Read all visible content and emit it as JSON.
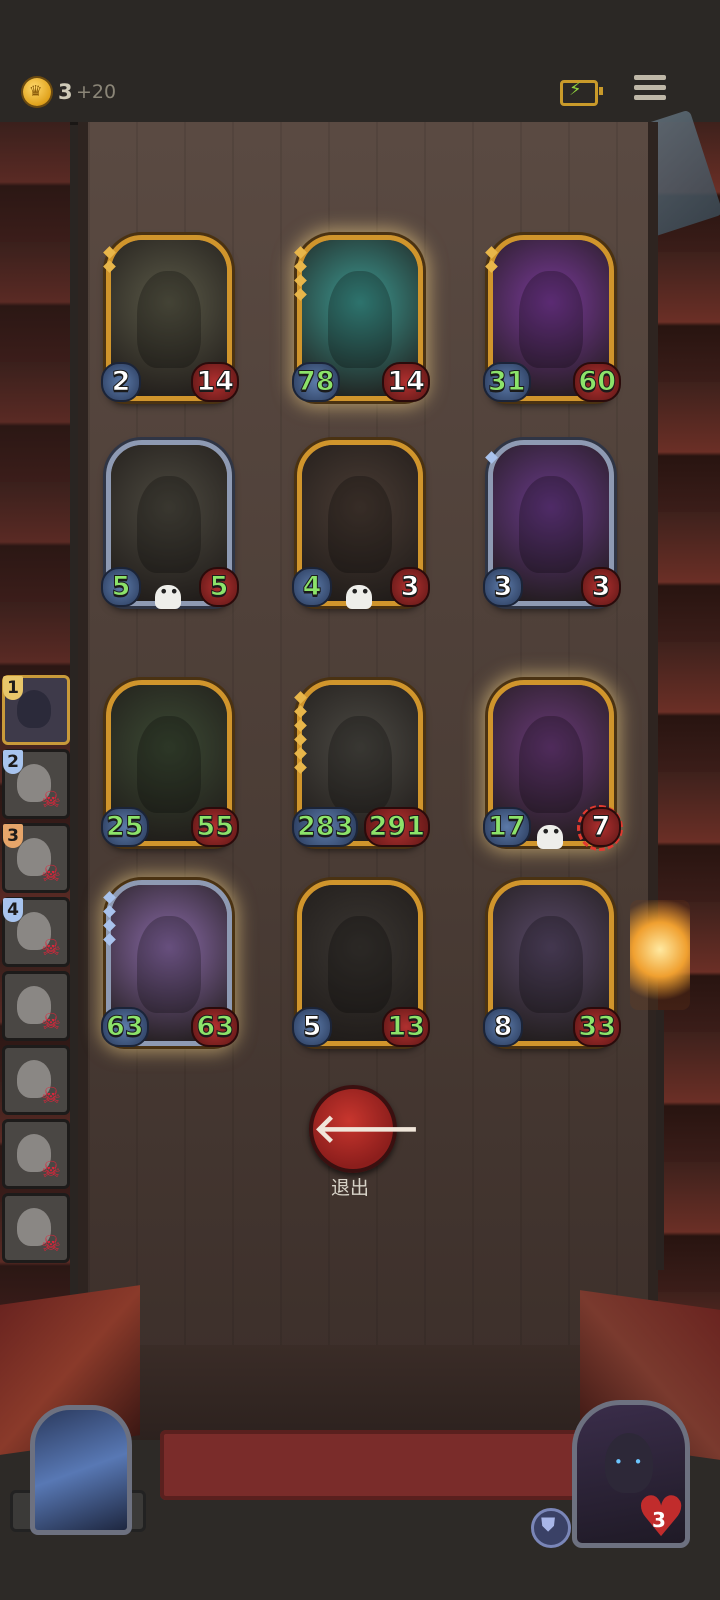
{
  "resources": {
    "gold": "3",
    "gold_income": "+20"
  },
  "team_ranks": [
    "1",
    "2",
    "3",
    "4"
  ],
  "board": [
    {
      "attack": "2",
      "health": "14",
      "attack_buffed": false,
      "health_buffed": false,
      "frame": "gold",
      "theme": "#5b5a48",
      "glow": false,
      "gems": 2,
      "skull": false,
      "target": false
    },
    {
      "attack": "78",
      "health": "14",
      "attack_buffed": true,
      "health_buffed": false,
      "frame": "gold",
      "theme": "#3d9a92",
      "glow": true,
      "gems": 4,
      "skull": false,
      "target": false
    },
    {
      "attack": "31",
      "health": "60",
      "attack_buffed": true,
      "health_buffed": true,
      "frame": "gold",
      "theme": "#7a3a9a",
      "glow": false,
      "gems": 2,
      "skull": false,
      "target": false
    },
    {
      "attack": "5",
      "health": "5",
      "attack_buffed": true,
      "health_buffed": true,
      "frame": "silver",
      "theme": "#4d4a40",
      "glow": false,
      "gems": 0,
      "skull": true,
      "target": false
    },
    {
      "attack": "4",
      "health": "3",
      "attack_buffed": true,
      "health_buffed": false,
      "frame": "gold",
      "theme": "#4a3c34",
      "glow": false,
      "gems": 0,
      "skull": true,
      "target": false
    },
    {
      "attack": "3",
      "health": "3",
      "attack_buffed": false,
      "health_buffed": false,
      "frame": "silver",
      "theme": "#6a3a8a",
      "glow": false,
      "gems": 1,
      "skull": false,
      "target": false
    },
    {
      "attack": "25",
      "health": "55",
      "attack_buffed": true,
      "health_buffed": true,
      "frame": "gold",
      "theme": "#3c4a34",
      "glow": false,
      "gems": 0,
      "skull": false,
      "target": false
    },
    {
      "attack": "283",
      "health": "291",
      "attack_buffed": true,
      "health_buffed": true,
      "frame": "gold",
      "theme": "#4c4a44",
      "glow": false,
      "gems": 6,
      "skull": false,
      "target": false
    },
    {
      "attack": "17",
      "health": "7",
      "attack_buffed": true,
      "health_buffed": false,
      "frame": "gold",
      "theme": "#6a3a7a",
      "glow": true,
      "gems": 0,
      "skull": true,
      "target": true
    },
    {
      "attack": "63",
      "health": "63",
      "attack_buffed": true,
      "health_buffed": true,
      "frame": "silver",
      "theme": "#8a6aa8",
      "glow": true,
      "gems": 4,
      "skull": false,
      "target": false
    },
    {
      "attack": "5",
      "health": "13",
      "attack_buffed": false,
      "health_buffed": true,
      "frame": "gold",
      "theme": "#3a3632",
      "glow": false,
      "gems": 0,
      "skull": false,
      "target": false
    },
    {
      "attack": "8",
      "health": "33",
      "attack_buffed": false,
      "health_buffed": true,
      "frame": "gold",
      "theme": "#5a4a6a",
      "glow": false,
      "gems": 0,
      "skull": false,
      "target": false
    }
  ],
  "exit": {
    "arrow": "🡐",
    "label": "退出"
  },
  "hero": {
    "health": "3"
  },
  "colors": {
    "buff": "#8ce36a",
    "base": "#ffffff",
    "gold_frame": "#d0952c",
    "silver_frame": "#8e9ab3"
  }
}
